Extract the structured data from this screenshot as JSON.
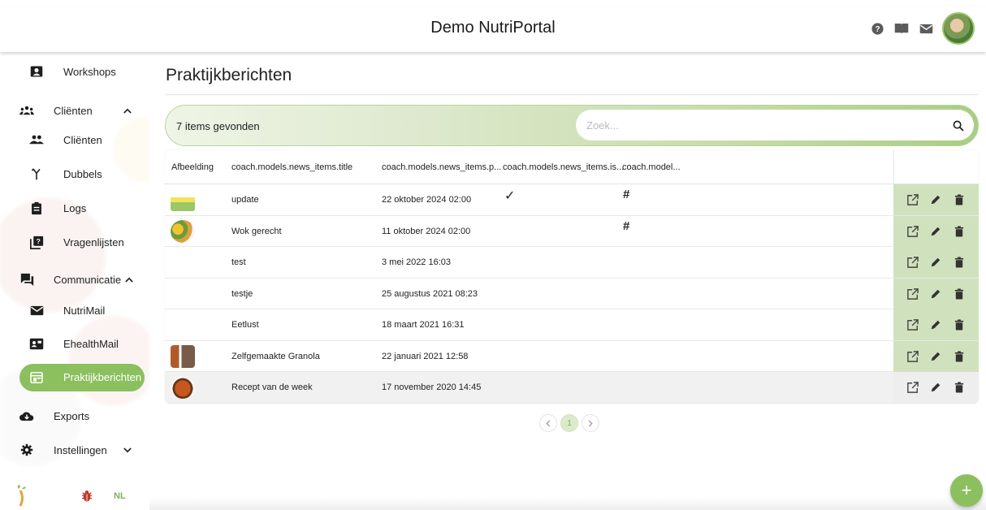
{
  "header": {
    "title": "Demo NutriPortal"
  },
  "sidebar": {
    "items": [
      {
        "label": "Workshops",
        "icon": "person-board-icon"
      },
      {
        "label": "Cliënten",
        "icon": "groups-icon"
      },
      {
        "label": "Cliënten",
        "icon": "people-icon"
      },
      {
        "label": "Dubbels",
        "icon": "merge-icon"
      },
      {
        "label": "Logs",
        "icon": "clipboard-icon"
      },
      {
        "label": "Vragenlijsten",
        "icon": "question-list-icon"
      },
      {
        "label": "Communicatie",
        "icon": "forum-icon"
      },
      {
        "label": "NutriMail",
        "icon": "mail-icon"
      },
      {
        "label": "EhealthMail",
        "icon": "contact-mail-icon"
      },
      {
        "label": "Praktijkberichten",
        "icon": "newspaper-icon"
      },
      {
        "label": "Exports",
        "icon": "cloud-download-icon"
      },
      {
        "label": "Instellingen",
        "icon": "gear-icon"
      }
    ],
    "footer": {
      "language": "NL"
    }
  },
  "main": {
    "title": "Praktijkberichten",
    "count_text": "7 items gevonden",
    "search": {
      "placeholder": "Zoek..."
    },
    "table": {
      "headers": [
        "Afbeelding",
        "coach.models.news_items.title",
        "coach.models.news_items.p...",
        "coach.models.news_items.is...",
        "coach.model..."
      ],
      "rows": [
        {
          "title": "update",
          "date": "22 oktober 2024 02:00"
        },
        {
          "title": "Wok gerecht",
          "date": "11 oktober 2024 02:00"
        },
        {
          "title": "test",
          "date": "3 mei 2022 16:03"
        },
        {
          "title": "testje",
          "date": "25 augustus 2021 08:23"
        },
        {
          "title": "Eetlust",
          "date": "18 maart 2021 16:31"
        },
        {
          "title": "Zelfgemaakte Granola",
          "date": "22 januari 2021 12:58"
        },
        {
          "title": "Recept van de week",
          "date": "17 november 2020 14:45"
        }
      ]
    },
    "pagination": {
      "current": "1"
    }
  },
  "colors": {
    "accent": "#8cbf5e",
    "accent_light": "#cfe2bd"
  }
}
